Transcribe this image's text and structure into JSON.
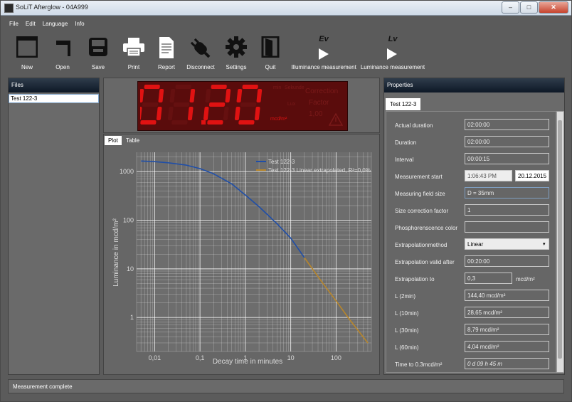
{
  "window": {
    "title": "SoLiT Afterglow - 04A999",
    "minimize": "–",
    "maximize": "□",
    "close": "✕"
  },
  "menu": [
    "File",
    "Edit",
    "Language",
    "Info"
  ],
  "toolbar": {
    "new": "New",
    "open": "Open",
    "save": "Save",
    "print": "Print",
    "report": "Report",
    "disconnect": "Disconnect",
    "settings": "Settings",
    "quit": "Quit",
    "illuminance_symbol": "Ev",
    "illuminance": "Illuminance measurement",
    "luminance_symbol": "Lv",
    "luminance": "Luminance measurement"
  },
  "files": {
    "header": "Files",
    "items": [
      "Test 122-3"
    ]
  },
  "display": {
    "digits": "01.20",
    "labels": [
      "min",
      "Sekunde",
      "Lux",
      "mcd/m²"
    ],
    "correction": "Correction",
    "factor": "Factor",
    "factor_value": "1,00",
    "colors": {
      "lcd_bg": "#5a0c0c",
      "segment_on": "#e01212",
      "segment_dim": "#7a1a1a"
    }
  },
  "plot_tabs": [
    "Plot",
    "Table"
  ],
  "chart_data": {
    "type": "line",
    "xlabel": "Decay time in minutes",
    "ylabel": "Luminance in mcd/m²",
    "xscale": "log",
    "yscale": "log",
    "xlim": [
      0.004,
      600
    ],
    "ylim": [
      0.2,
      2500
    ],
    "x_ticks": [
      "0,01",
      "0,1",
      "1",
      "10",
      "100"
    ],
    "x_tick_values": [
      0.01,
      0.1,
      1,
      10,
      100
    ],
    "y_ticks": [
      "1",
      "10",
      "100",
      "1000"
    ],
    "y_tick_values": [
      1,
      10,
      100,
      1000
    ],
    "grid": true,
    "legend_position": "top-right",
    "series": [
      {
        "name": "Test 122-3",
        "color": "#1f4ea8",
        "x": [
          0.005,
          0.01,
          0.02,
          0.05,
          0.1,
          0.2,
          0.5,
          1,
          2,
          5,
          10,
          20
        ],
        "y": [
          1650,
          1600,
          1520,
          1360,
          1150,
          900,
          560,
          330,
          190,
          85,
          43,
          17
        ]
      },
      {
        "name": "Test 122-3 Linear extrapolated, R²=0,0%",
        "color": "#b8862a",
        "x": [
          20,
          50,
          100,
          200,
          500
        ],
        "y": [
          17,
          5.2,
          2.2,
          0.9,
          0.3
        ]
      }
    ]
  },
  "properties": {
    "header": "Properties",
    "tab": "Test 122-3",
    "rows": [
      {
        "label": "Actual duration",
        "value": "02:00:00"
      },
      {
        "label": "Duration",
        "value": "02:00:00"
      },
      {
        "label": "Interval",
        "value": "00:00:15"
      },
      {
        "label": "Measurement start",
        "value": "1:06:43 PM",
        "value2": "20.12.2015"
      },
      {
        "label": "Measuring field size",
        "value": "D = 35mm"
      },
      {
        "label": "Size correction factor",
        "value": "1"
      },
      {
        "label": "Phosphorenscence color",
        "value": ""
      },
      {
        "label": "Extrapolationmethod",
        "value": "Linear"
      },
      {
        "label": "Extrapolation valid after",
        "value": "00:20:00"
      },
      {
        "label": "Extrapolation to",
        "value": "0,3",
        "unit": "mcd/m²"
      },
      {
        "label": "L (2min)",
        "value": "144,40 mcd/m²"
      },
      {
        "label": "L (10min)",
        "value": "28,65 mcd/m²"
      },
      {
        "label": "L (30min)",
        "value": "8,79 mcd/m²"
      },
      {
        "label": "L (60min)",
        "value": "4,04 mcd/m²"
      },
      {
        "label": "Time to 0.3mcd/m²",
        "value": "0 d 09 h 45 m"
      }
    ]
  },
  "status": "Measurement complete"
}
